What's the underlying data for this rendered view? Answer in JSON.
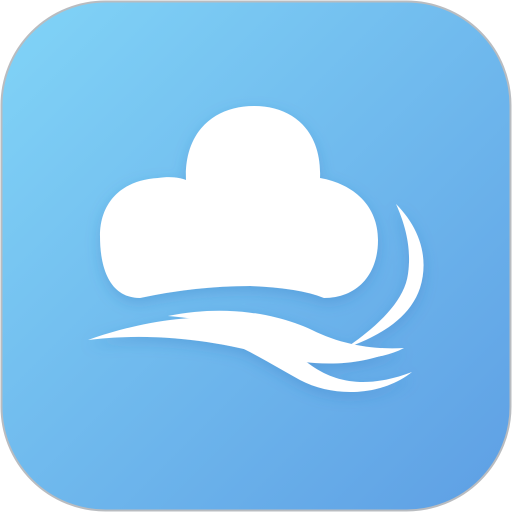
{
  "app_icon": {
    "name": "weather-app-icon",
    "glyph": "cloud-and-wind-icon",
    "colors": {
      "gradient_top_left": "#81D4F7",
      "gradient_bottom_right": "#5E9FE4",
      "border": "#B9BCC0",
      "glyph": "#FFFFFF",
      "glyph_shadow": "#2B6FB8"
    }
  }
}
